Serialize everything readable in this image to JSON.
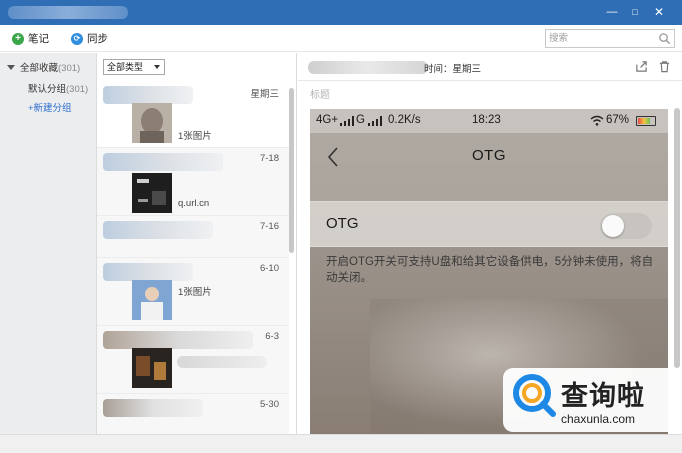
{
  "window": {
    "controls": {
      "minimize": "—",
      "maximize": "□",
      "close": "✕"
    }
  },
  "toolbar": {
    "note_label": "笔记",
    "sync_label": "同步",
    "search_placeholder": "搜索"
  },
  "sidebar": {
    "all_label": "全部收藏",
    "all_count": "(301)",
    "default_label": "默认分组",
    "default_count": "(301)",
    "new_group_label": "+新建分组"
  },
  "list": {
    "filter_value": "全部类型",
    "items": [
      {
        "date": "星期三",
        "caption": "1张图片",
        "selected": true
      },
      {
        "date": "7-18",
        "caption": "q.url.cn"
      },
      {
        "date": "7-16",
        "caption": ""
      },
      {
        "date": "6-10",
        "caption": "1张图片"
      },
      {
        "date": "6-3",
        "caption": ""
      },
      {
        "date": "5-30",
        "caption": ""
      }
    ]
  },
  "detail": {
    "time_text": "时间：星期三",
    "title_placeholder": "标题",
    "phone": {
      "net1": "4G+",
      "net2": "G",
      "speed": "0.2K/s",
      "clock": "18:23",
      "battery": "67%",
      "nav_title": "OTG",
      "row_label": "OTG",
      "toggle_on": false,
      "description": "开启OTG开关可支持U盘和给其它设备供电，5分钟未使用，将自动关闭。"
    }
  },
  "watermark": {
    "brand_cn": "查询啦",
    "brand_url": "chaxunla.com"
  },
  "colors": {
    "titlebar": "#2f6eb5",
    "accent_link": "#2f6fd1",
    "note_icon": "#3aa64a",
    "sync_icon": "#2f8ede",
    "watermark_blue": "#1e88e5",
    "watermark_orange": "#f5a623"
  }
}
